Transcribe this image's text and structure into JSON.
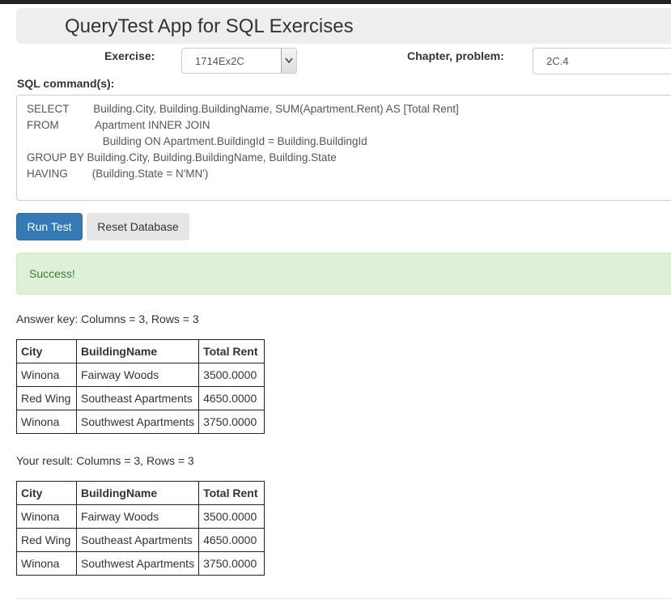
{
  "header": {
    "title": "QueryTest App for SQL Exercises"
  },
  "form": {
    "exercise_label": "Exercise:",
    "exercise_value": "1714Ex2C",
    "chapter_label": "Chapter, problem:",
    "chapter_value": "2C.4",
    "sql_label": "SQL command(s):"
  },
  "sql": {
    "lines": [
      "SELECT        Building.City, Building.BuildingName, SUM(Apartment.Rent) AS [Total Rent]",
      "FROM            Apartment INNER JOIN",
      "                         Building ON Apartment.BuildingId = Building.BuildingId",
      "GROUP BY Building.City, Building.BuildingName, Building.State",
      "HAVING        (Building.State = N'MN')"
    ]
  },
  "buttons": {
    "run": "Run Test",
    "reset": "Reset Database"
  },
  "alert": {
    "message": "Success!"
  },
  "answer_key": {
    "summary": "Answer key: Columns = 3, Rows = 3",
    "columns": [
      "City",
      "BuildingName",
      "Total Rent"
    ],
    "rows": [
      [
        "Winona",
        "Fairway Woods",
        "3500.0000"
      ],
      [
        "Red Wing",
        "Southeast Apartments",
        "4650.0000"
      ],
      [
        "Winona",
        "Southwest Apartments",
        "3750.0000"
      ]
    ]
  },
  "your_result": {
    "summary": "Your result: Columns = 3, Rows = 3",
    "columns": [
      "City",
      "BuildingName",
      "Total Rent"
    ],
    "rows": [
      [
        "Winona",
        "Fairway Woods",
        "3500.0000"
      ],
      [
        "Red Wing",
        "Southeast Apartments",
        "4650.0000"
      ],
      [
        "Winona",
        "Southwest Apartments",
        "3750.0000"
      ]
    ]
  },
  "icons": {
    "select_arrow": "chevron-down-icon"
  },
  "colors": {
    "primary": "#337ab7",
    "success_bg": "#dff0d8",
    "success_text": "#3c763d"
  }
}
